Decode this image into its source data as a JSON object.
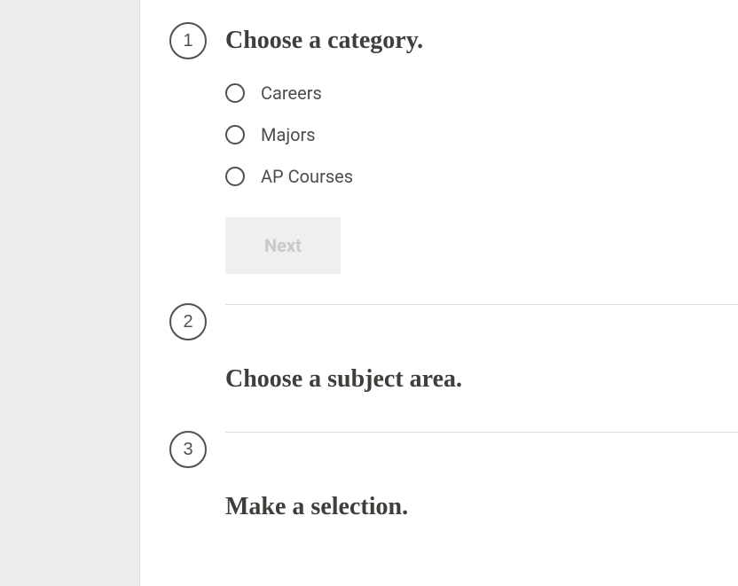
{
  "steps": [
    {
      "number": "1",
      "title": "Choose a category.",
      "options": [
        {
          "label": "Careers"
        },
        {
          "label": "Majors"
        },
        {
          "label": "AP Courses"
        }
      ],
      "next_button": "Next"
    },
    {
      "number": "2",
      "title": "Choose a subject area."
    },
    {
      "number": "3",
      "title": "Make a selection."
    }
  ]
}
